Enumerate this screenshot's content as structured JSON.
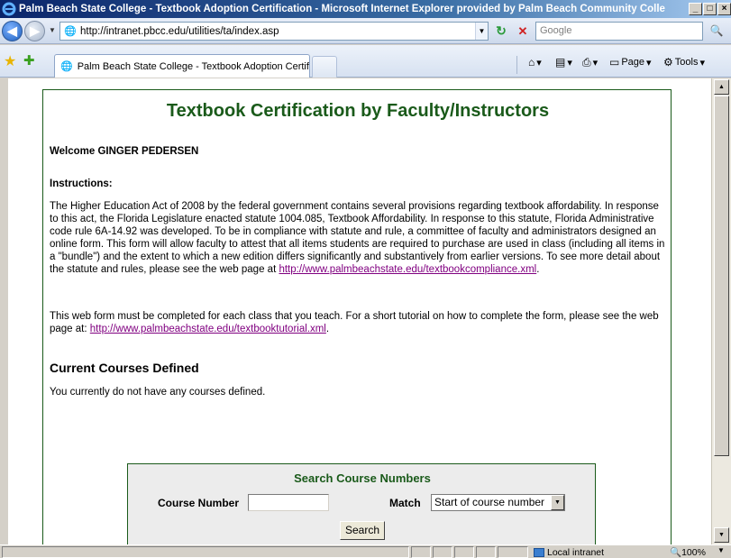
{
  "window": {
    "title": "Palm Beach State College - Textbook Adoption Certification - Microsoft Internet Explorer provided by Palm Beach Community Colle",
    "minimize_label": "_",
    "maximize_label": "□",
    "close_label": "×"
  },
  "navbar": {
    "address": "http://intranet.pbcc.edu/utilities/ta/index.asp",
    "search_placeholder": "Google"
  },
  "tabs": {
    "active_tab_title": "Palm Beach State College - Textbook Adoption Certific...",
    "commands": {
      "page_label": "Page",
      "tools_label": "Tools"
    }
  },
  "page": {
    "heading": "Textbook Certification by Faculty/Instructors",
    "welcome": "Welcome GINGER PEDERSEN",
    "instructions_heading": "Instructions:",
    "instructions_text": "The Higher Education Act of 2008 by the federal government contains several provisions regarding textbook affordability. In response to this act, the Florida Legislature enacted statute 1004.085, Textbook Affordability. In response to this statute, Florida Administrative code rule 6A-14.92 was developed. To be in compliance with statute and rule, a committee of faculty and administrators designed an online form. This form will allow faculty to attest that all items students are required to purchase are used in class (including all items in a \"bundle\") and the extent to which a new edition differs significantly and substantively from earlier versions. To see more detail about the statute and rules, please see the web page at",
    "compliance_link": "http://www.palmbeachstate.edu/textbookcompliance.xml",
    "tutorial_text": "This web form must be completed for each class that you teach. For a short tutorial on how to complete the form, please see the web page at:",
    "tutorial_link": "http://www.palmbeachstate.edu/textbooktutorial.xml",
    "courses_heading": "Current Courses Defined",
    "no_courses": "You currently do not have any courses defined.",
    "search": {
      "title": "Search Course Numbers",
      "course_number_label": "Course Number",
      "course_number_value": "",
      "match_label": "Match",
      "match_selected": "Start of course number",
      "button_label": "Search"
    }
  },
  "statusbar": {
    "zone": "Local intranet",
    "zoom": "100%"
  }
}
